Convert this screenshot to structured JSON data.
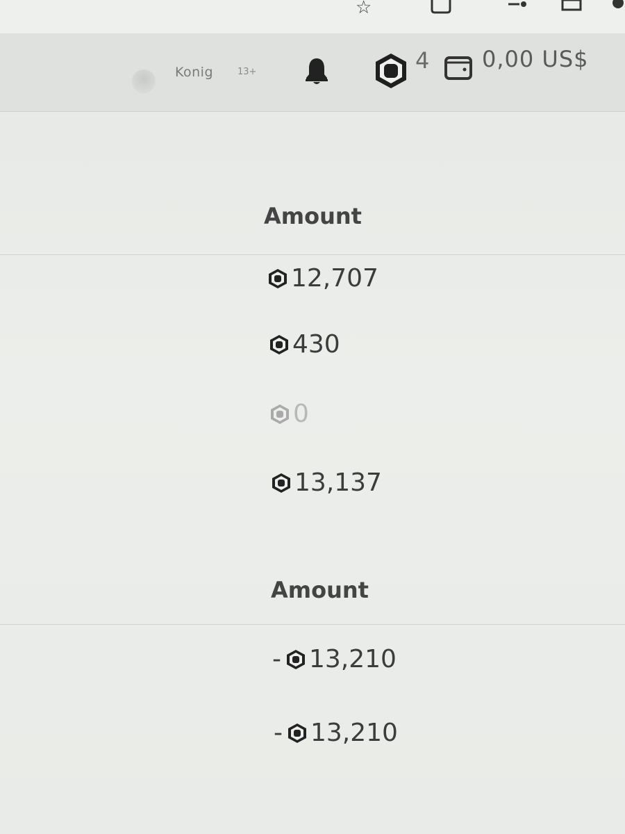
{
  "header": {
    "username": "Konig",
    "age_badge": "13+",
    "robux_count": "4",
    "wallet_balance": "0,00 US$"
  },
  "section_1": {
    "column_header": "Amount",
    "rows": [
      {
        "amount": "12,707",
        "muted": false
      },
      {
        "amount": "430",
        "muted": false
      },
      {
        "amount": "0",
        "muted": true
      },
      {
        "amount": "13,137",
        "muted": false
      }
    ]
  },
  "section_2": {
    "column_header": "Amount",
    "rows": [
      {
        "prefix": "-",
        "amount": "13,210"
      },
      {
        "prefix": "-",
        "amount": "13,210"
      }
    ]
  },
  "icons": {
    "star": "star-icon",
    "bell": "bell-icon",
    "robux": "robux-icon",
    "wallet": "wallet-icon"
  },
  "colors": {
    "text_primary": "#3c3c3c",
    "text_muted": "#b8b8b8",
    "header_bg": "#dfe1de"
  }
}
